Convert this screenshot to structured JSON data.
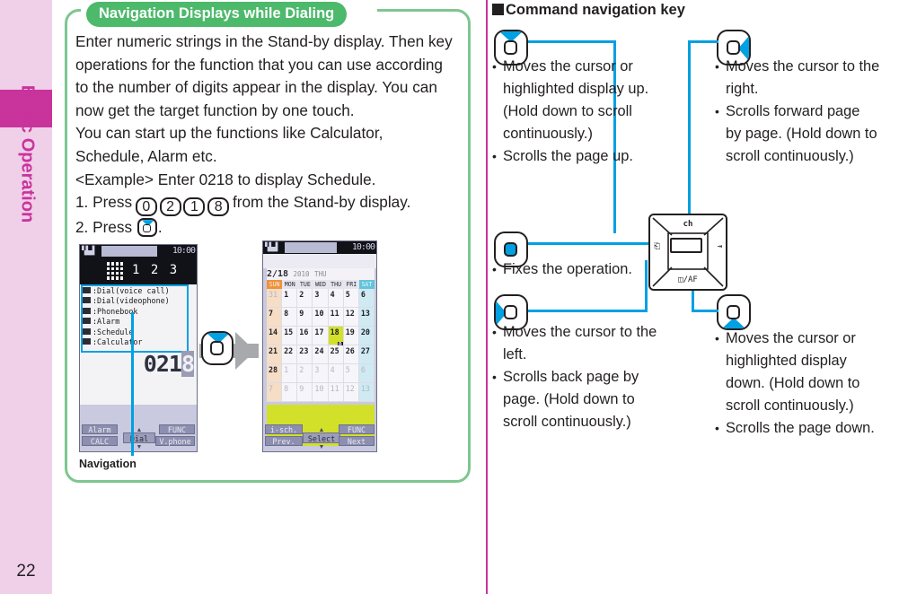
{
  "sidebar": {
    "chapter_label": "Basic Operation",
    "page_number": "22",
    "tab_color": "#c9339c",
    "bg_color": "#f0cfe8"
  },
  "left_panel": {
    "box_title": "Navigation Displays while Dialing",
    "title_bg": "#4cb96b",
    "border_color": "#7ec691",
    "paragraph_lines": [
      "Enter numeric strings in the Stand-by display. Then key",
      "operations for the function that you can use according",
      "to the number of digits appear in the display. You can",
      "now get the target function by one touch.",
      "You can start up the functions like Calculator,",
      "Schedule, Alarm etc.",
      "<Example> Enter 0218 to display Schedule."
    ],
    "step1_prefix": "1. Press",
    "step1_keys": [
      "0",
      "2",
      "1",
      "8"
    ],
    "step1_suffix": "from the Stand-by display.",
    "step2_prefix": "2. Press",
    "step2_suffix": ".",
    "callout_caption": "Navigation"
  },
  "phone1": {
    "status_signal": "▚▙▟",
    "status_clock": "10:00",
    "entered_digits_display": "1 2 3 ...",
    "menu_items": [
      ":Dial(voice call)",
      ":Dial(videophone)",
      ":Phonebook",
      ":Alarm",
      ":Schedule",
      ":Calculator"
    ],
    "dialed_number": "021",
    "dialed_number_highlight": "8",
    "softkeys": {
      "top_left": "Alarm",
      "bottom_left": "CALC",
      "center": "Dial",
      "top_right": "FUNC",
      "bottom_right": "V.phone"
    }
  },
  "phone2": {
    "status_signal": "▚▙▟",
    "status_clock": "10:00",
    "cal_date": "2/18",
    "cal_year": "2010",
    "cal_weekday": "THU",
    "day_headers": [
      "SUN",
      "MON",
      "TUE",
      "WED",
      "THU",
      "FRI",
      "SAT"
    ],
    "weeks": [
      [
        {
          "d": "31",
          "dim": true
        },
        {
          "d": "1"
        },
        {
          "d": "2"
        },
        {
          "d": "3"
        },
        {
          "d": "4"
        },
        {
          "d": "5"
        },
        {
          "d": "6"
        }
      ],
      [
        {
          "d": "7"
        },
        {
          "d": "8"
        },
        {
          "d": "9"
        },
        {
          "d": "10"
        },
        {
          "d": "11"
        },
        {
          "d": "12"
        },
        {
          "d": "13"
        }
      ],
      [
        {
          "d": "14"
        },
        {
          "d": "15"
        },
        {
          "d": "16"
        },
        {
          "d": "17"
        },
        {
          "d": "18",
          "sel": true,
          "mark": "0"
        },
        {
          "d": "19"
        },
        {
          "d": "20"
        }
      ],
      [
        {
          "d": "21"
        },
        {
          "d": "22"
        },
        {
          "d": "23"
        },
        {
          "d": "24"
        },
        {
          "d": "25"
        },
        {
          "d": "26"
        },
        {
          "d": "27"
        }
      ],
      [
        {
          "d": "28"
        },
        {
          "d": "1",
          "dim": true
        },
        {
          "d": "2",
          "dim": true
        },
        {
          "d": "3",
          "dim": true
        },
        {
          "d": "4",
          "dim": true
        },
        {
          "d": "5",
          "dim": true
        },
        {
          "d": "6",
          "dim": true
        }
      ],
      [
        {
          "d": "7",
          "dim": true
        },
        {
          "d": "8",
          "dim": true
        },
        {
          "d": "9",
          "dim": true
        },
        {
          "d": "10",
          "dim": true
        },
        {
          "d": "11",
          "dim": true
        },
        {
          "d": "12",
          "dim": true
        },
        {
          "d": "13",
          "dim": true
        }
      ]
    ],
    "note_mark": "0",
    "softkeys": {
      "top_left": "i-sch.",
      "bottom_left": "Prev.",
      "center": "Select",
      "top_right": "FUNC",
      "bottom_right": "Next"
    }
  },
  "right_panel": {
    "heading": "Command navigation key",
    "keys": [
      {
        "id": "up",
        "direction": "up",
        "bullets": [
          "Moves the cursor or highlighted display up. (Hold down to scroll continuously.)",
          "Scrolls the page up."
        ]
      },
      {
        "id": "right",
        "direction": "right",
        "bullets": [
          "Moves the cursor to the right.",
          "Scrolls forward page by page. (Hold down to scroll continuously.)"
        ]
      },
      {
        "id": "center",
        "direction": "center",
        "bullets": [
          "Fixes the operation."
        ]
      },
      {
        "id": "left",
        "direction": "left",
        "bullets": [
          "Moves the cursor to the left.",
          "Scrolls back page by page. (Hold down to scroll continuously.)"
        ]
      },
      {
        "id": "down",
        "direction": "down",
        "bullets": [
          "Moves the cursor or highlighted display down. (Hold down to scroll continuously.)",
          "Scrolls the page down."
        ]
      }
    ],
    "keypad_labels": {
      "top": "ch",
      "bottom": "/AF",
      "left": "⎗",
      "right": "⇥"
    },
    "accent_color": "#00a0e2"
  },
  "desc_text": {
    "up_l1": "Moves the cursor or",
    "up_l2": "highlighted display up.",
    "up_l3": "(Hold down to scroll",
    "up_l4": "continuously.)",
    "up_l5": "Scrolls the page up.",
    "right_l1": "Moves the cursor to the",
    "right_l2": "right.",
    "right_l3": "Scrolls forward page",
    "right_l4": "by page. (Hold down to",
    "right_l5": "scroll continuously.)",
    "center_l1": "Fixes the operation.",
    "left_l1": "Moves the cursor to the",
    "left_l2": "left.",
    "left_l3": "Scrolls back page by",
    "left_l4": "page. (Hold down to",
    "left_l5": "scroll continuously.)",
    "down_l1": "Moves the cursor or",
    "down_l2": "highlighted display",
    "down_l3": "down. (Hold down to",
    "down_l4": "scroll continuously.)",
    "down_l5": "Scrolls the page down."
  }
}
